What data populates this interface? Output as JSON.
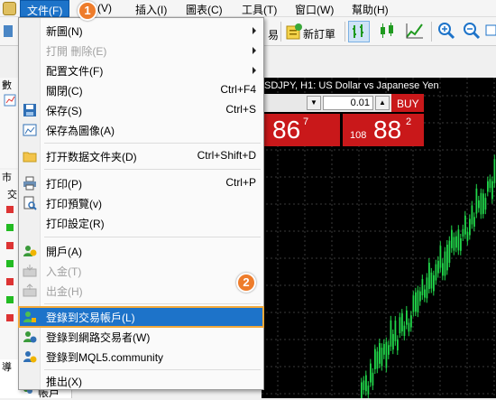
{
  "menubar": {
    "items": [
      {
        "label": "文件(F)"
      },
      {
        "label": "(V)"
      },
      {
        "label": "插入(I)"
      },
      {
        "label": "圖表(C)"
      },
      {
        "label": "工具(T)"
      },
      {
        "label": "窗口(W)"
      },
      {
        "label": "幫助(H)"
      }
    ]
  },
  "toolbar": {
    "order_fragment": "易",
    "new_order_label": "新訂單"
  },
  "chart": {
    "title": "SDJPY, H1:  US Dollar vs Japanese Yen",
    "lot_value": "0.01",
    "buy_label": "BUY",
    "sell_price_main": "86",
    "sell_price_sup": "7",
    "buy_price_prefix": "108",
    "buy_price_main": "88",
    "buy_price_sup": "2"
  },
  "left_panels": {
    "panel1_fragment": "數",
    "panel2_fragment": "市",
    "panel2_sub": "交",
    "panel3_fragment": "導",
    "panel3_item": "帳戶"
  },
  "file_menu": {
    "items": [
      {
        "label": "新圖(N)",
        "shortcut": "",
        "submenu": true
      },
      {
        "label": "打開 刪除(E)",
        "shortcut": "",
        "submenu": true,
        "disabled": true
      },
      {
        "label": "配置文件(F)",
        "shortcut": "",
        "submenu": true
      },
      {
        "label": "關閉(C)",
        "shortcut": "Ctrl+F4"
      },
      {
        "label": "保存(S)",
        "shortcut": "Ctrl+S"
      },
      {
        "label": "保存為圖像(A)",
        "shortcut": ""
      },
      {
        "label": "打开数据文件夹(D)",
        "shortcut": "Ctrl+Shift+D"
      },
      {
        "label": "打印(P)",
        "shortcut": "Ctrl+P"
      },
      {
        "label": "打印預覽(v)",
        "shortcut": ""
      },
      {
        "label": "打印設定(R)",
        "shortcut": ""
      },
      {
        "label": "開戶(A)",
        "shortcut": ""
      },
      {
        "label": "入金(T)",
        "shortcut": "",
        "disabled": true
      },
      {
        "label": "出金(H)",
        "shortcut": "",
        "disabled": true
      },
      {
        "label": "登錄到交易帳戶(L)",
        "shortcut": "",
        "highlighted": true
      },
      {
        "label": "登錄到網路交易者(W)",
        "shortcut": ""
      },
      {
        "label": "登錄到MQL5.community",
        "shortcut": ""
      },
      {
        "label": "推出(X)",
        "shortcut": ""
      }
    ]
  },
  "annotations": {
    "step1": "1",
    "step2": "2"
  },
  "colors": {
    "accent_blue": "#1d73c9",
    "highlight_outline": "#f2a93b",
    "badge_orange": "#ee7c2b",
    "candle_green": "#21d64a",
    "sell_buy_red": "#c9181a"
  }
}
